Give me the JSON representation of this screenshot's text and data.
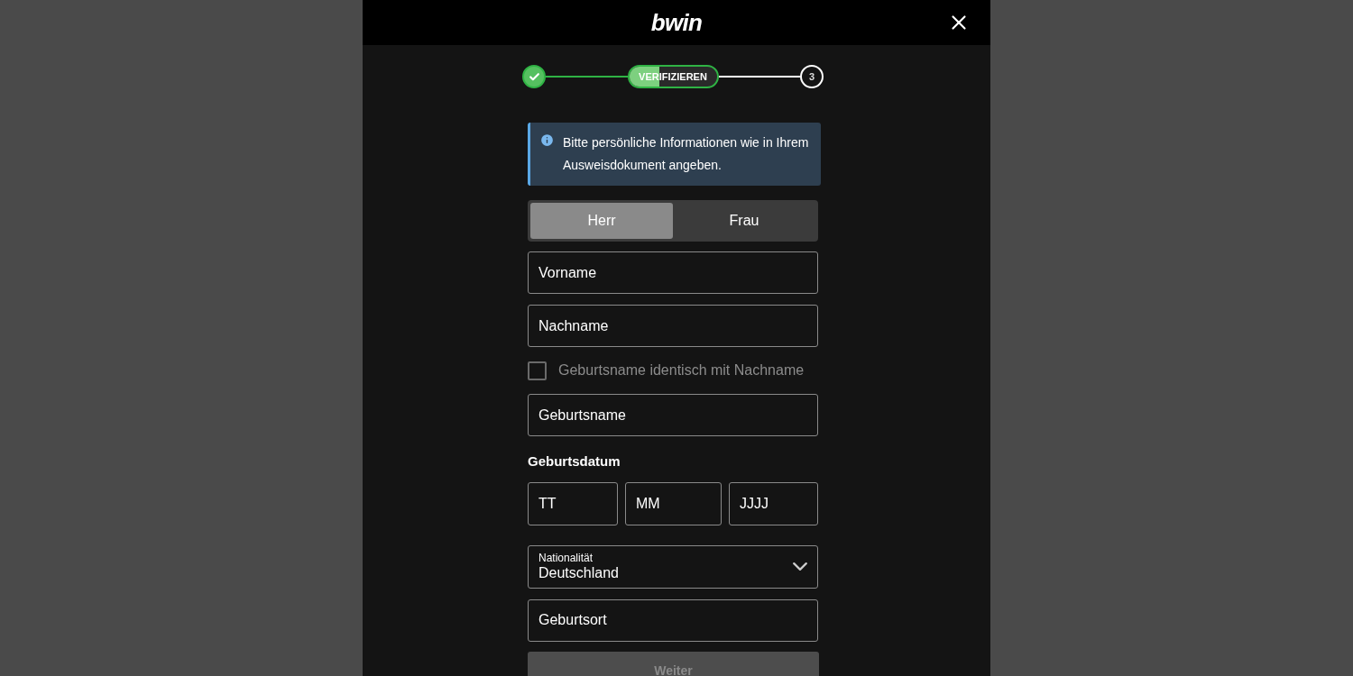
{
  "header": {
    "logo": "bwin"
  },
  "steps": [
    {
      "kind": "done"
    },
    {
      "kind": "current",
      "label": "VERIFIZIEREN",
      "level": 0.35
    },
    {
      "kind": "pending",
      "label": "3"
    }
  ],
  "info": {
    "text": "Bitte persönliche Informationen wie in Ihrem Ausweisdokument angeben."
  },
  "salutation": [
    {
      "label": "Herr",
      "selected": true
    },
    {
      "label": "Frau",
      "selected": false
    }
  ],
  "name_fields": [
    {
      "placeholder": "Vorname"
    },
    {
      "placeholder": "Nachname"
    }
  ],
  "same_name": {
    "label": "Geburtsname identisch mit Nachname",
    "checked": false
  },
  "birth_name": {
    "placeholder": "Geburtsname"
  },
  "birth_date": {
    "label": "Geburtsdatum",
    "fields": [
      {
        "placeholder": "TT"
      },
      {
        "placeholder": "MM"
      },
      {
        "placeholder": "JJJJ"
      }
    ]
  },
  "nationality": {
    "label": "Nationalität",
    "value": "Deutschland"
  },
  "birth_place": {
    "placeholder": "Geburtsort"
  },
  "submit": {
    "label": "Weiter",
    "disabled": true
  }
}
